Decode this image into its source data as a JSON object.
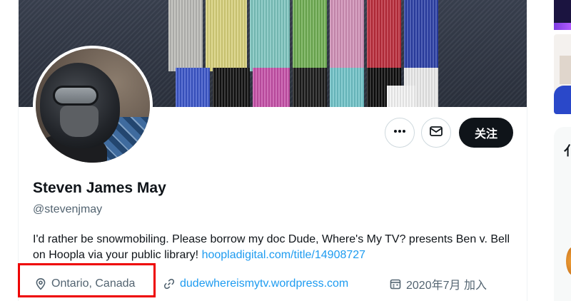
{
  "profile": {
    "name": "Steven James May",
    "handle": "@stevenjmay",
    "bio_text": "I'd rather be snowmobiling. Please borrow my doc Dude, Where's My TV? presents Ben v. Bell on Hoopla via your public library! ",
    "bio_link": "hoopladigital.com/title/14908727",
    "location": "Ontario, Canada",
    "website": "dudewhereismytv.wordpress.com",
    "joined": "2020年7月 加入"
  },
  "actions": {
    "more_icon": "more-horizontal-icon",
    "message_icon": "envelope-icon",
    "follow_label": "关注"
  },
  "icons": {
    "location": "map-pin-icon",
    "website": "link-icon",
    "joined": "calendar-icon"
  },
  "rail": {
    "partial_glyph": "亻"
  },
  "colors": {
    "accent_link": "#1d9bf0",
    "highlight": "#ee0000",
    "follow_bg": "#0f1419",
    "secondary_text": "#536471"
  }
}
